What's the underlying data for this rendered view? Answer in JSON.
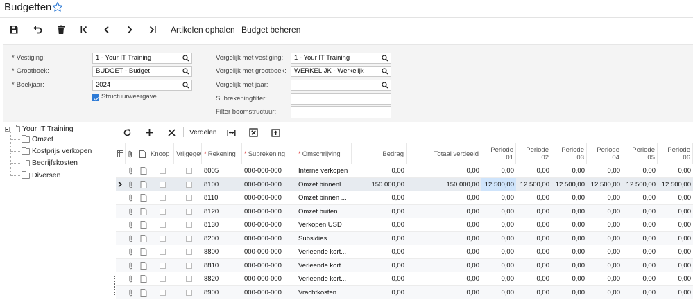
{
  "title": "Budgetten",
  "toolbar": {
    "artikelen_label": "Artikelen ophalen",
    "budget_label": "Budget beheren"
  },
  "form": {
    "vestiging_label": "Vestiging:",
    "vestiging_value": "1 - Your IT Training",
    "grootboek_label": "Grootboek:",
    "grootboek_value": "BUDGET - Budget",
    "boekjaar_label": "Boekjaar:",
    "boekjaar_value": "2024",
    "structuur_label": "Structuurweergave",
    "structuur_checked": true,
    "vgl_vestiging_label": "Vergelijk met vestiging:",
    "vgl_vestiging_value": "1 - Your IT Training",
    "vgl_grootboek_label": "Vergelijk met grootboek:",
    "vgl_grootboek_value": "WERKELIJK - Werkelijk",
    "vgl_jaar_label": "Vergelijk met jaar:",
    "vgl_jaar_value": "",
    "subrekening_filter_label": "Subrekeningfilter:",
    "filter_boom_label": "Filter boomstructuur:"
  },
  "tree": {
    "root": "Your IT Training",
    "children": [
      "Omzet",
      "Kostprijs verkopen",
      "Bedrijfskosten",
      "Diversen"
    ]
  },
  "grid_toolbar": {
    "verdelen_label": "Verdelen"
  },
  "columns": {
    "knoop": "Knoop",
    "vrijgegeven": "Vrijgegeven",
    "rekening": "Rekening",
    "subrekening": "Subrekening",
    "omschrijving": "Omschrijving",
    "bedrag": "Bedrag",
    "totaal": "Totaal verdeeld",
    "p01a": "Periode",
    "p01b": "01",
    "p02a": "Periode",
    "p02b": "02",
    "p03a": "Periode",
    "p03b": "03",
    "p04a": "Periode",
    "p04b": "04",
    "p05a": "Periode",
    "p05b": "05",
    "p06a": "Periode",
    "p06b": "06"
  },
  "rows": [
    {
      "rek": "8005",
      "sub": "000-000-000",
      "oms": "Interne verkopen",
      "bedrag": "0,00",
      "totaal": "0,00",
      "p": [
        "0,00",
        "0,00",
        "0,00",
        "0,00",
        "0,00",
        "0,00"
      ]
    },
    {
      "rek": "8100",
      "sub": "000-000-000",
      "oms": "Omzet binnenl...",
      "bedrag": "150.000,00",
      "totaal": "150.000,00",
      "p": [
        "12.500,00",
        "12.500,00",
        "12.500,00",
        "12.500,00",
        "12.500,00",
        "12.500,00"
      ]
    },
    {
      "rek": "8110",
      "sub": "000-000-000",
      "oms": "Omzet binnen ...",
      "bedrag": "0,00",
      "totaal": "0,00",
      "p": [
        "0,00",
        "0,00",
        "0,00",
        "0,00",
        "0,00",
        "0,00"
      ]
    },
    {
      "rek": "8120",
      "sub": "000-000-000",
      "oms": "Omzet buiten ...",
      "bedrag": "0,00",
      "totaal": "0,00",
      "p": [
        "0,00",
        "0,00",
        "0,00",
        "0,00",
        "0,00",
        "0,00"
      ]
    },
    {
      "rek": "8130",
      "sub": "000-000-000",
      "oms": "Verkopen USD",
      "bedrag": "0,00",
      "totaal": "0,00",
      "p": [
        "0,00",
        "0,00",
        "0,00",
        "0,00",
        "0,00",
        "0,00"
      ]
    },
    {
      "rek": "8200",
      "sub": "000-000-000",
      "oms": "Subsidies",
      "bedrag": "0,00",
      "totaal": "0,00",
      "p": [
        "0,00",
        "0,00",
        "0,00",
        "0,00",
        "0,00",
        "0,00"
      ]
    },
    {
      "rek": "8800",
      "sub": "000-000-000",
      "oms": "Verleende kort...",
      "bedrag": "0,00",
      "totaal": "0,00",
      "p": [
        "0,00",
        "0,00",
        "0,00",
        "0,00",
        "0,00",
        "0,00"
      ]
    },
    {
      "rek": "8810",
      "sub": "000-000-000",
      "oms": "Verleende kort...",
      "bedrag": "0,00",
      "totaal": "0,00",
      "p": [
        "0,00",
        "0,00",
        "0,00",
        "0,00",
        "0,00",
        "0,00"
      ]
    },
    {
      "rek": "8820",
      "sub": "000-000-000",
      "oms": "Verleende kort...",
      "bedrag": "0,00",
      "totaal": "0,00",
      "p": [
        "0,00",
        "0,00",
        "0,00",
        "0,00",
        "0,00",
        "0,00"
      ]
    },
    {
      "rek": "8900",
      "sub": "000-000-000",
      "oms": "Vrachtkosten",
      "bedrag": "0,00",
      "totaal": "0,00",
      "p": [
        "0,00",
        "0,00",
        "0,00",
        "0,00",
        "0,00",
        "0,00"
      ]
    }
  ],
  "selected_row": 1,
  "selected_cell": "p01",
  "accent": "#2e7bd6",
  "icons": {
    "toolbar": [
      "save-icon",
      "undo-icon",
      "delete-icon",
      "first-icon",
      "prev-icon",
      "next-icon",
      "last-icon"
    ],
    "grid": [
      "refresh-icon",
      "add-icon",
      "remove-icon",
      "fit-width-icon",
      "excel-icon",
      "upload-icon"
    ]
  }
}
